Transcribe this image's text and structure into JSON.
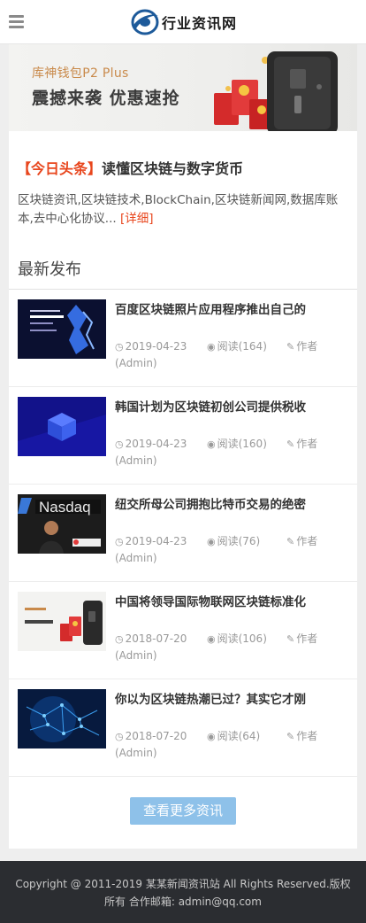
{
  "header": {
    "menu_icon": "hamburger-icon",
    "logo_icon": "globe-logo-icon",
    "logo_text": "行业资讯网"
  },
  "banner": {
    "subtitle": "库神钱包P2 Plus",
    "title": "震撼来袭 优惠速抢"
  },
  "headline": {
    "tag": "【今日头条】",
    "title": "读懂区块链与数字货币",
    "description": "区块链资讯,区块链技术,BlockChain,区块链新闻网,数据库账本,去中心化协议...",
    "more_link": "[详细]"
  },
  "latest": {
    "title": "最新发布",
    "items": [
      {
        "title": "百度区块链照片应用程序推出自己的",
        "date": "2019-04-23",
        "views": "阅读(164)",
        "author": "作者(Admin)",
        "thumb": "baidu-blockchain"
      },
      {
        "title": "韩国计划为区块链初创公司提供税收",
        "date": "2019-04-23",
        "views": "阅读(160)",
        "author": "作者(Admin)",
        "thumb": "blue-cube"
      },
      {
        "title": "纽交所母公司拥抱比特币交易的绝密",
        "date": "2019-04-23",
        "views": "阅读(76)",
        "author": "作者(Admin)",
        "thumb": "nasdaq"
      },
      {
        "title": "中国将领导国际物联网区块链标准化",
        "date": "2018-07-20",
        "views": "阅读(106)",
        "author": "作者(Admin)",
        "thumb": "wallet-ad"
      },
      {
        "title": "你以为区块链热潮已过？其实它才刚",
        "date": "2018-07-20",
        "views": "阅读(64)",
        "author": "作者(Admin)",
        "thumb": "blue-network"
      }
    ]
  },
  "load_more": "查看更多资讯",
  "footer": {
    "text": "Copyright @ 2011-2019 某某新闻资讯站 All Rights Reserved.版权所有 合作邮箱: admin@qq.com"
  },
  "colors": {
    "accent_red": "#e8461d",
    "button_blue": "#8ec1e9",
    "footer_bg": "#2b2d31"
  }
}
